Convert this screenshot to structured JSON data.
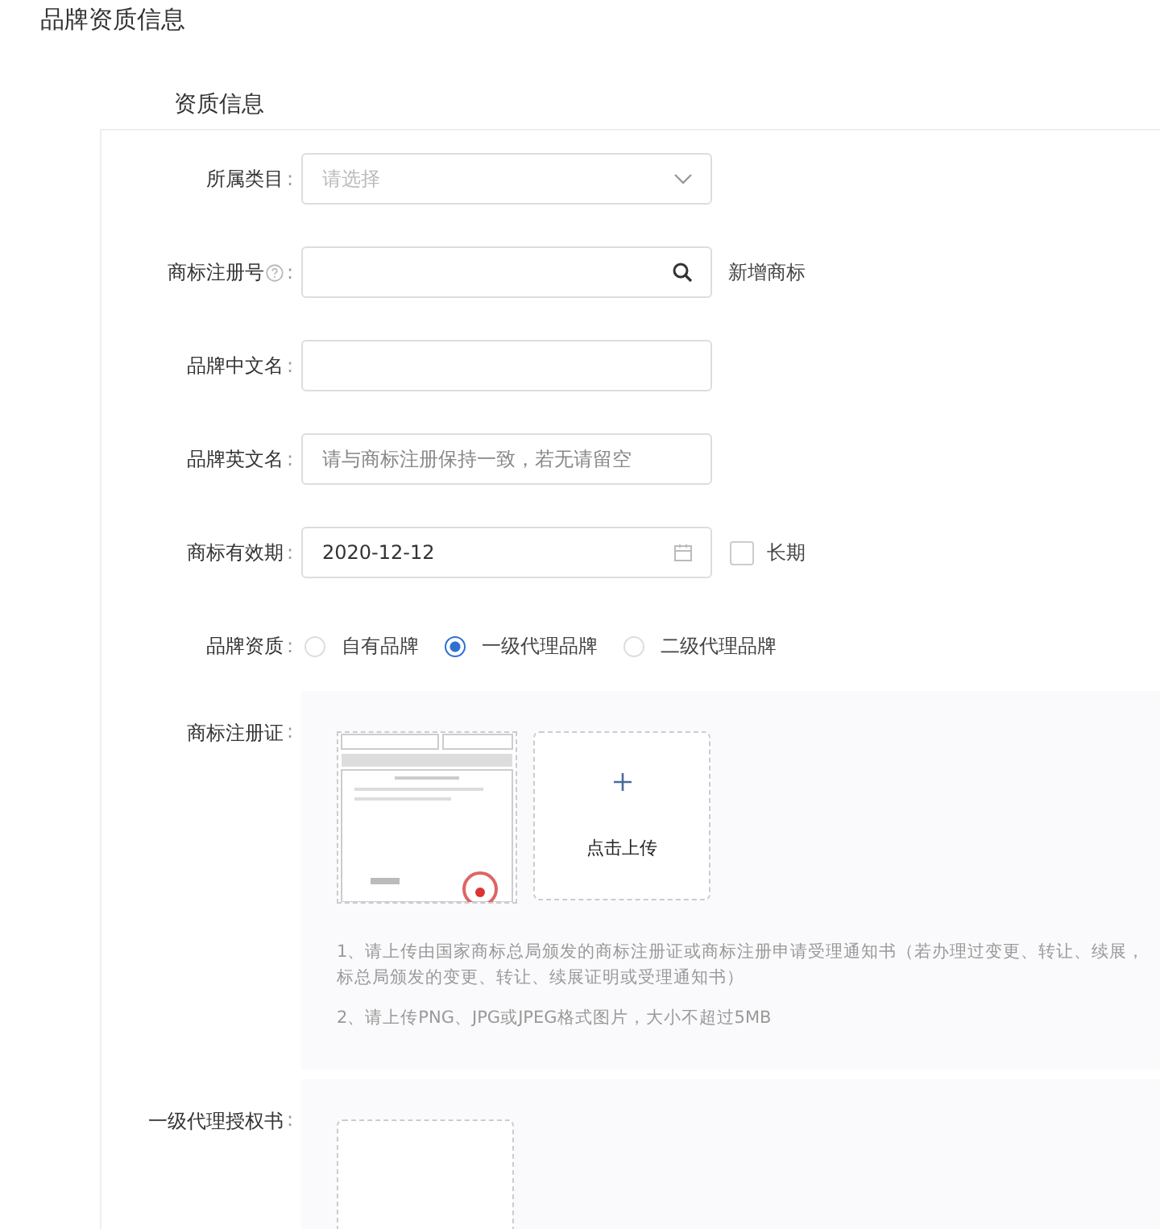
{
  "page_title": "品牌资质信息",
  "section_title": "资质信息",
  "fields": [
    {
      "kind": "select",
      "label": "所属类目",
      "colon": ":",
      "placeholder": "请选择"
    },
    {
      "kind": "search",
      "label": "商标注册号",
      "help": true,
      "colon": ":",
      "action": "新增商标"
    },
    {
      "kind": "text",
      "label": "品牌中文名",
      "colon": ":"
    },
    {
      "kind": "text",
      "label": "品牌英文名",
      "colon": ":",
      "placeholder": "请与商标注册保持一致，若无请留空"
    },
    {
      "kind": "date",
      "label": "商标有效期",
      "colon": ":",
      "value": "2020-12-12",
      "checkbox": {
        "label": "长期",
        "checked": false
      }
    },
    {
      "kind": "radio",
      "label": "品牌资质",
      "colon": ":",
      "options": [
        {
          "label": "自有品牌",
          "selected": false
        },
        {
          "label": "一级代理品牌",
          "selected": true
        },
        {
          "label": "二级代理品牌",
          "selected": false
        }
      ]
    }
  ],
  "uploads": [
    {
      "label": "商标注册证",
      "colon": ":",
      "has_image": true,
      "upload_label": "点击上传",
      "notes": [
        "1、请上传由国家商标总局颁发的商标注册证或商标注册申请受理通知书（若办理过变更、转让、续展，",
        "标总局颁发的变更、转让、续展证明或受理通知书）",
        "2、请上传PNG、JPG或JPEG格式图片，大小不超过5MB"
      ]
    },
    {
      "label": "一级代理授权书",
      "colon": ":",
      "has_image": false
    }
  ]
}
